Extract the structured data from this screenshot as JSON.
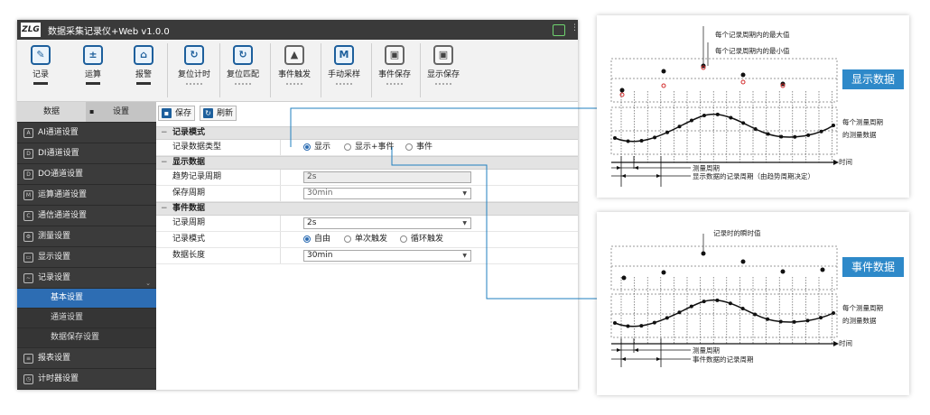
{
  "app": {
    "title": "数据采集记录仪+Web v1.0.0",
    "logo": "ZLG"
  },
  "toolbar": {
    "buttons": [
      {
        "label": "记录",
        "icon": "record-edit-icon"
      },
      {
        "label": "运算",
        "icon": "calculator-icon"
      },
      {
        "label": "报警",
        "icon": "alarm-icon"
      },
      {
        "label": "复位计时",
        "icon": "reset-timer-icon"
      },
      {
        "label": "复位匹配",
        "icon": "reset-match-icon"
      },
      {
        "label": "事件触发",
        "icon": "event-trigger-icon"
      },
      {
        "label": "手动采样",
        "icon": "manual-sample-icon"
      },
      {
        "label": "事件保存",
        "icon": "event-save-icon"
      },
      {
        "label": "显示保存",
        "icon": "display-save-icon"
      }
    ]
  },
  "sidebar": {
    "tabs": [
      "数据",
      "设置"
    ],
    "items": [
      {
        "label": "AI通道设置",
        "icon": "AI"
      },
      {
        "label": "DI通道设置",
        "icon": "DI"
      },
      {
        "label": "DO通道设置",
        "icon": "DO"
      },
      {
        "label": "运算通道设置",
        "icon": "M"
      },
      {
        "label": "通信通道设置",
        "icon": "C"
      },
      {
        "label": "测量设置",
        "icon": "gear"
      },
      {
        "label": "显示设置",
        "icon": "monitor"
      },
      {
        "label": "记录设置",
        "icon": "chart"
      }
    ],
    "subitems": [
      "基本设置",
      "通道设置",
      "数据保存设置"
    ],
    "items_after": [
      {
        "label": "报表设置",
        "icon": "report"
      },
      {
        "label": "计时器设置",
        "icon": "timer"
      }
    ]
  },
  "main": {
    "save_label": "保存",
    "refresh_label": "刷新",
    "section_record_mode": "记录模式",
    "row_record_type_label": "记录数据类型",
    "record_type_options": [
      "显示",
      "显示+事件",
      "事件"
    ],
    "record_type_selected": 0,
    "section_display_data": "显示数据",
    "row_trend_period_label": "趋势记录周期",
    "trend_period_value": "2s",
    "row_save_period_label": "保存周期",
    "save_period_value": "30min",
    "section_event_data": "事件数据",
    "row_record_period_label": "记录周期",
    "record_period_value": "2s",
    "row_record_mode_label": "记录模式",
    "record_mode_options": [
      "自由",
      "单次触发",
      "循环触发"
    ],
    "record_mode_selected": 0,
    "row_data_length_label": "数据长度",
    "data_length_value": "30min"
  },
  "diagram_display": {
    "badge": "显示数据",
    "max_label": "每个记录周期内的最大值",
    "min_label": "每个记录周期内的最小值",
    "measure_label": "每个测量周期\n的测量数据",
    "time_label": "时间",
    "period_label": "测量周期",
    "record_period_label": "显示数据的记录周期（由趋势周期决定）"
  },
  "diagram_event": {
    "badge": "事件数据",
    "instant_label": "记录时的瞬时值",
    "measure_label": "每个测量周期\n的测量数据",
    "time_label": "时间",
    "period_label": "测量周期",
    "record_period_label": "事件数据的记录周期"
  },
  "colors": {
    "accent": "#2e89c9",
    "selected": "#2d6db3",
    "connector": "#1f7fbf",
    "red_point": "#d22a2a"
  }
}
